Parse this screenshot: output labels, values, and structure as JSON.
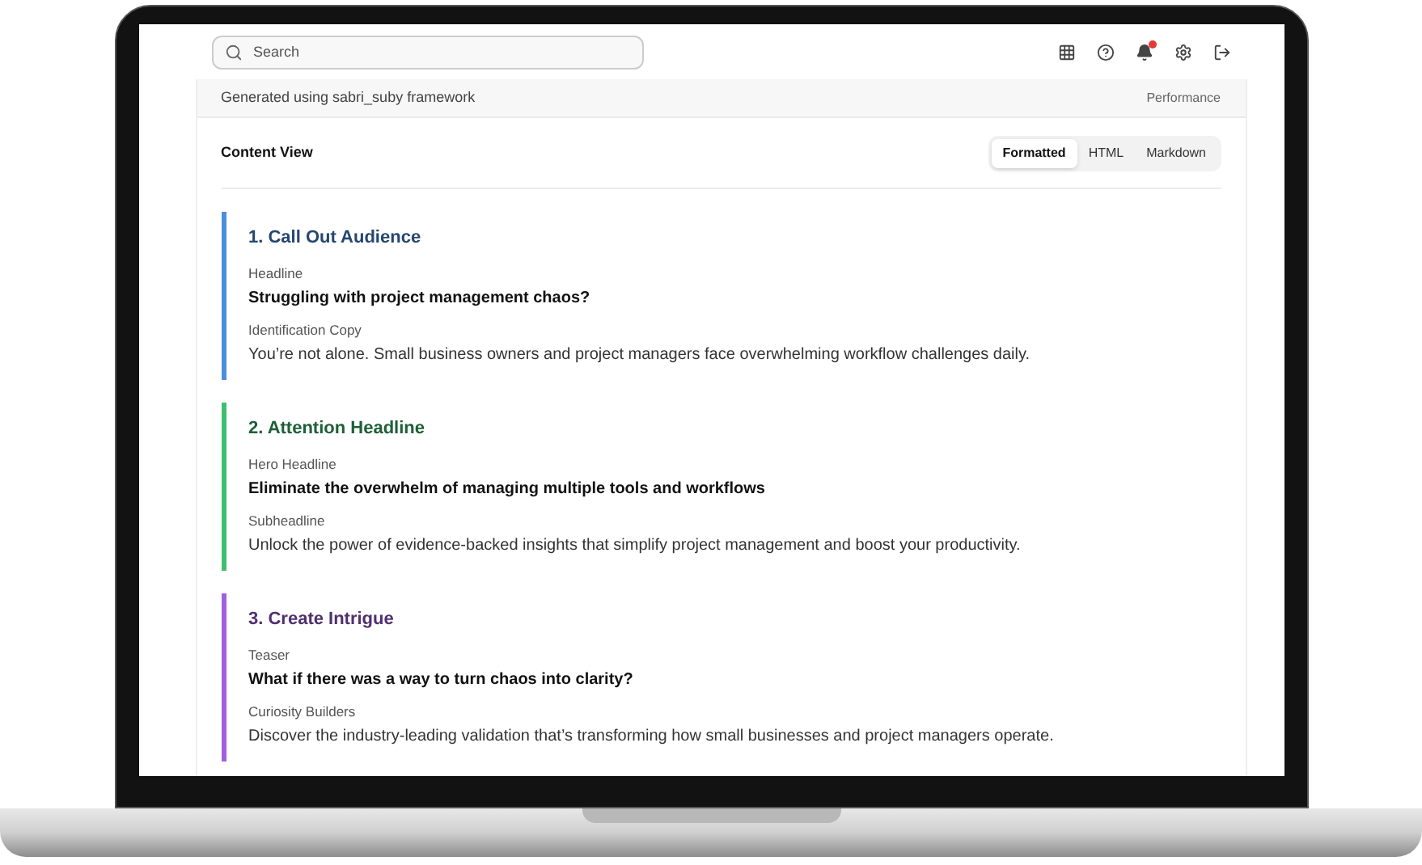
{
  "search": {
    "placeholder": "Search"
  },
  "notifications": {
    "unread": true
  },
  "header": {
    "subtitle": "Generated using sabri_suby framework",
    "link": "Performance"
  },
  "content_view": {
    "title": "Content View",
    "tabs": [
      {
        "label": "Formatted",
        "selected": true
      },
      {
        "label": "HTML",
        "selected": false
      },
      {
        "label": "Markdown",
        "selected": false
      }
    ]
  },
  "sections": [
    {
      "title": "1. Call Out Audience",
      "color": "#4a8ee0",
      "fields": [
        {
          "kind": "headline",
          "label": "Headline",
          "value": "Struggling with project management chaos?"
        },
        {
          "kind": "copy",
          "label": "Identification Copy",
          "value": "You’re not alone. Small business owners and project managers face overwhelming workflow challenges daily."
        }
      ]
    },
    {
      "title": "2. Attention Headline",
      "color": "#3cbf6e",
      "fields": [
        {
          "kind": "headline",
          "label": "Hero Headline",
          "value": "Eliminate the overwhelm of managing multiple tools and workflows"
        },
        {
          "kind": "copy",
          "label": "Subheadline",
          "value": "Unlock the power of evidence-backed insights that simplify project management and boost your productivity."
        }
      ]
    },
    {
      "title": "3. Create Intrigue",
      "color": "#a25fe0",
      "fields": [
        {
          "kind": "headline",
          "label": "Teaser",
          "value": "What if there was a way to turn chaos into clarity?"
        },
        {
          "kind": "copy",
          "label": "Curiosity Builders",
          "value": "Discover the industry-leading validation that’s transforming how small businesses and project managers operate."
        }
      ]
    }
  ]
}
